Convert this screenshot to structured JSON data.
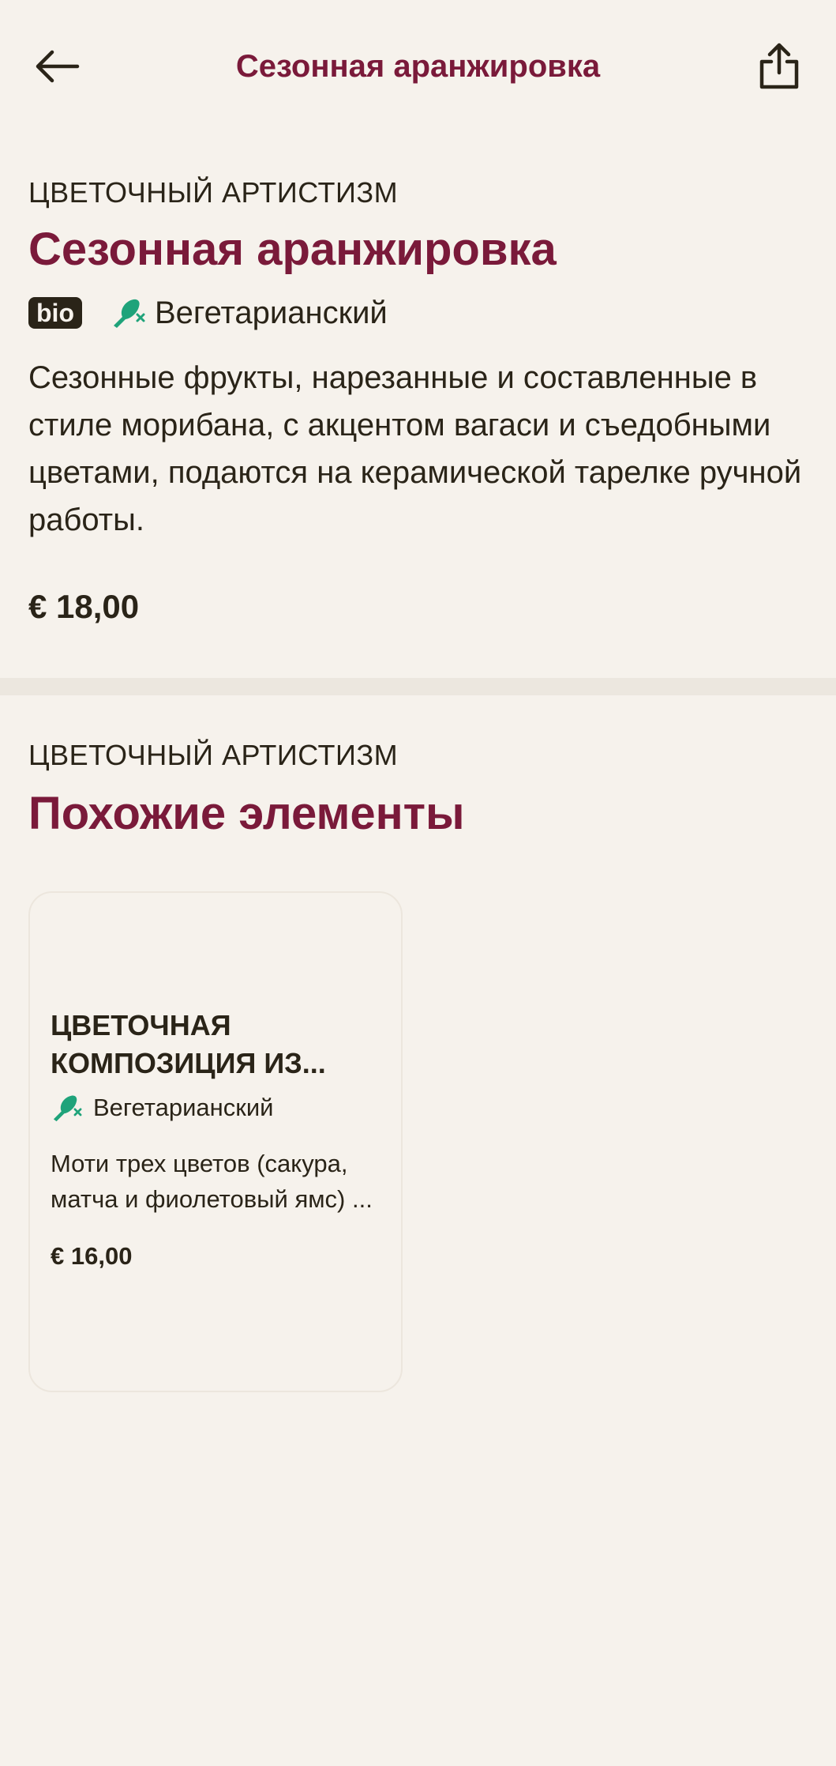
{
  "header": {
    "title": "Сезонная аранжировка",
    "back_icon": "arrow-left-icon",
    "share_icon": "share-icon"
  },
  "product": {
    "category": "ЦВЕТОЧНЫЙ АРТИСТИЗМ",
    "title": "Сезонная аранжировка",
    "badge": "bio",
    "diet_label": "Вегетарианский",
    "description": "Сезонные фрукты, нарезанные и составленные в стиле морибана, с акцентом вагаси и съедобными цветами, подаются на керамической тарелке ручной работы.",
    "price": "€ 18,00"
  },
  "similar": {
    "category": "ЦВЕТОЧНЫЙ АРТИСТИЗМ",
    "title": "Похожие элементы",
    "items": [
      {
        "title": "ЦВЕТОЧНАЯ КОМПОЗИЦИЯ ИЗ...",
        "diet_label": "Вегетарианский",
        "description": "Моти трех цветов (сакура, матча и фиолетовый ямс) ...",
        "price": "€ 16,00"
      }
    ]
  },
  "colors": {
    "background": "#F6F2EC",
    "accent": "#7A1A3A",
    "text": "#2A2418",
    "veg_green": "#1FA37A",
    "divider": "#ECE7DF"
  }
}
